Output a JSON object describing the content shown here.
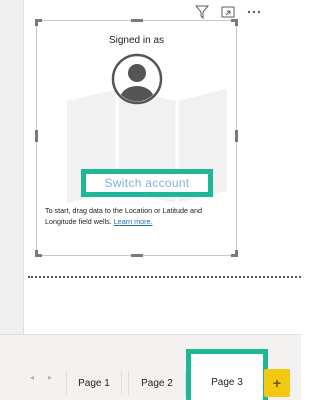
{
  "visual_header": {
    "icons": [
      "filter-icon",
      "focus-mode-icon",
      "more-options-icon"
    ]
  },
  "visual": {
    "signed_in_label": "Signed in as",
    "switch_account_label": "Switch account",
    "instructions_text": "To start, drag data to the Location or Latitude and Longitude field wells. ",
    "learn_more_label": "Learn more."
  },
  "page_tabs": {
    "prev_label": "◂",
    "next_label": "▸",
    "items": [
      {
        "label": "Page 1",
        "active": false
      },
      {
        "label": "Page 2",
        "active": false
      },
      {
        "label": "Page 3",
        "active": true
      }
    ],
    "add_label": "+"
  },
  "colors": {
    "highlight": "#1fb896",
    "add_page": "#f2c811",
    "link": "#1f6fb5"
  }
}
